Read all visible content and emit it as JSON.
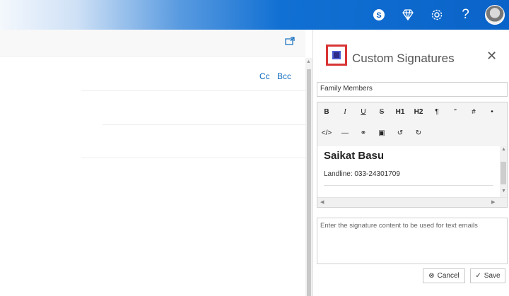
{
  "topbar": {
    "icons": [
      "skype-icon",
      "diamond-icon",
      "gear-icon",
      "help-icon",
      "avatar"
    ],
    "help_glyph": "?"
  },
  "compose": {
    "cc_label": "Cc",
    "bcc_label": "Bcc"
  },
  "panel": {
    "title": "Custom Signatures",
    "close_glyph": "✕",
    "signature_name": "Family Members",
    "toolbar_row1": [
      "B",
      "I",
      "U",
      "S",
      "H1",
      "H2",
      "¶",
      "\"",
      "#",
      "•"
    ],
    "toolbar_row2": [
      "</>",
      "—",
      "⚭",
      "▣",
      "↺",
      "↻"
    ],
    "signature_content": {
      "name": "Saikat Basu",
      "line": "Landline: 033-24301709"
    },
    "text_placeholder": "Enter the signature content to be used for text emails",
    "cancel_label": "Cancel",
    "save_label": "Save"
  },
  "colors": {
    "accent": "#0f6cbd",
    "topbar": "#0a63c8",
    "logo_red": "#d83434",
    "logo_blue": "#2f2c87"
  }
}
